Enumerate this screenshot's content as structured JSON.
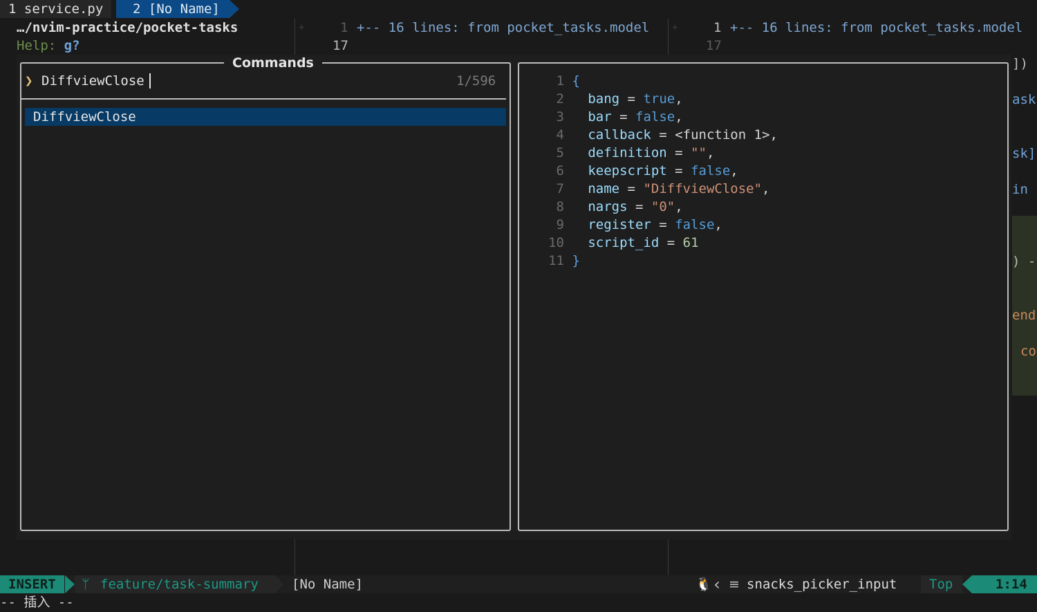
{
  "tabline": {
    "tabs": [
      {
        "label": "1 service.py"
      },
      {
        "label": "2 [No Name]"
      }
    ]
  },
  "background": {
    "path": "…/nvim-practice/pocket-tasks",
    "help_label": "Help:",
    "help_key": "g?",
    "diff_left": {
      "plus": "+",
      "num1": "1",
      "fold": "+-- 16 lines: from pocket_tasks.model",
      "num2": "17"
    },
    "diff_right": {
      "plus": "+",
      "num1": "1",
      "fold": "+-- 16 lines: from pocket_tasks.model",
      "num2": "17"
    },
    "peek_lines": [
      "])",
      "ask",
      "sk]",
      "in",
      ") -",
      "end",
      "co"
    ]
  },
  "picker": {
    "title": "Commands",
    "prompt_icon": "chevron-right-icon",
    "query": "DiffviewClose",
    "count": "1/596",
    "results": [
      "DiffviewClose"
    ]
  },
  "preview": {
    "lines": [
      {
        "n": "1",
        "open": "{"
      },
      {
        "n": "2",
        "key": "bang",
        "val": "true",
        "type": "bool",
        "tail": ","
      },
      {
        "n": "3",
        "key": "bar",
        "val": "false",
        "type": "bool",
        "tail": ","
      },
      {
        "n": "4",
        "key": "callback",
        "val": "<function 1>",
        "type": "op",
        "tail": ","
      },
      {
        "n": "5",
        "key": "definition",
        "val": "\"\"",
        "type": "str",
        "tail": ","
      },
      {
        "n": "6",
        "key": "keepscript",
        "val": "false",
        "type": "bool",
        "tail": ","
      },
      {
        "n": "7",
        "key": "name",
        "val": "\"DiffviewClose\"",
        "type": "str",
        "tail": ","
      },
      {
        "n": "8",
        "key": "nargs",
        "val": "\"0\"",
        "type": "str",
        "tail": ","
      },
      {
        "n": "9",
        "key": "register",
        "val": "false",
        "type": "bool",
        "tail": ","
      },
      {
        "n": "10",
        "key": "script_id",
        "val": "61",
        "type": "num",
        "tail": ""
      },
      {
        "n": "11",
        "close": "}"
      }
    ]
  },
  "statusline": {
    "mode": "INSERT",
    "branch_icon": "git-branch-icon",
    "branch": "feature/task-summary",
    "filename": "[No Name]",
    "os_icon": "linux-icon",
    "filetype_icon": "lines-icon",
    "filetype": "snacks_picker_input",
    "position": "Top",
    "cursor": "1:14",
    "colors": {
      "mode_bg": "#1b8a76",
      "branch_fg": "#1b9a86"
    }
  },
  "cmdline": "-- 插入 --"
}
